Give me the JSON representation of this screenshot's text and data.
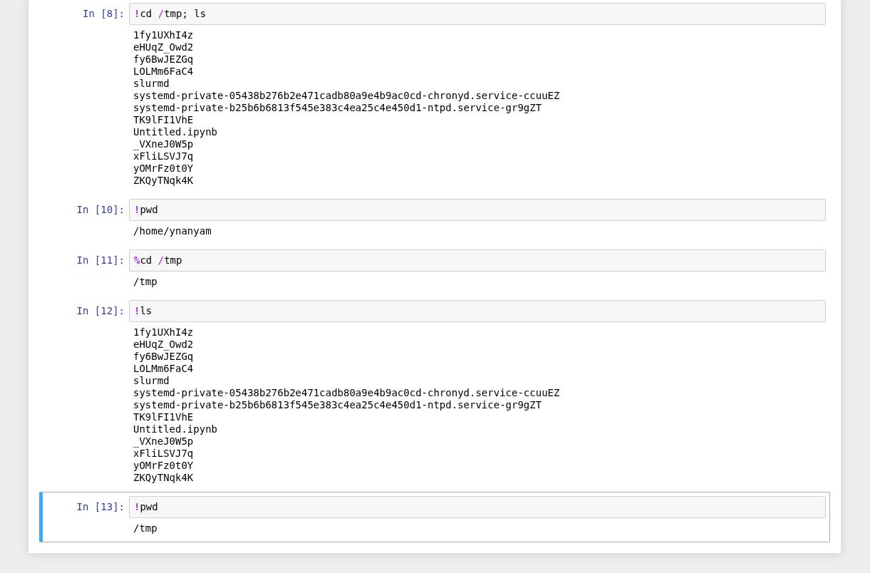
{
  "cells": [
    {
      "prompt": "In [8]:",
      "selected": false,
      "code": [
        {
          "kind": "magic",
          "text": "!"
        },
        {
          "kind": "plain",
          "text": "cd "
        },
        {
          "kind": "operator",
          "text": "/"
        },
        {
          "kind": "plain",
          "text": "tmp; ls"
        }
      ],
      "output": [
        "1fy1UXhI4z",
        "eHUqZ_Owd2",
        "fy6BwJEZGq",
        "LOLMm6FaC4",
        "slurmd",
        "systemd-private-05438b276b2e471cadb80a9e4b9ac0cd-chronyd.service-ccuuEZ",
        "systemd-private-b25b6b6813f545e383c4ea25c4e450d1-ntpd.service-gr9gZT",
        "TK9lFI1VhE",
        "Untitled.ipynb",
        "_VXneJ0W5p",
        "xFliLSVJ7q",
        "yOMrFz0t0Y",
        "ZKQyTNqk4K"
      ]
    },
    {
      "prompt": "In [10]:",
      "selected": false,
      "code": [
        {
          "kind": "magic",
          "text": "!"
        },
        {
          "kind": "plain",
          "text": "pwd"
        }
      ],
      "output": [
        "/home/ynanyam"
      ]
    },
    {
      "prompt": "In [11]:",
      "selected": false,
      "code": [
        {
          "kind": "magic",
          "text": "%"
        },
        {
          "kind": "plain",
          "text": "cd "
        },
        {
          "kind": "operator",
          "text": "/"
        },
        {
          "kind": "plain",
          "text": "tmp"
        }
      ],
      "output": [
        "/tmp"
      ]
    },
    {
      "prompt": "In [12]:",
      "selected": false,
      "code": [
        {
          "kind": "magic",
          "text": "!"
        },
        {
          "kind": "plain",
          "text": "ls"
        }
      ],
      "output": [
        "1fy1UXhI4z",
        "eHUqZ_Owd2",
        "fy6BwJEZGq",
        "LOLMm6FaC4",
        "slurmd",
        "systemd-private-05438b276b2e471cadb80a9e4b9ac0cd-chronyd.service-ccuuEZ",
        "systemd-private-b25b6b6813f545e383c4ea25c4e450d1-ntpd.service-gr9gZT",
        "TK9lFI1VhE",
        "Untitled.ipynb",
        "_VXneJ0W5p",
        "xFliLSVJ7q",
        "yOMrFz0t0Y",
        "ZKQyTNqk4K"
      ]
    },
    {
      "prompt": "In [13]:",
      "selected": true,
      "code": [
        {
          "kind": "magic",
          "text": "!"
        },
        {
          "kind": "plain",
          "text": "pwd"
        }
      ],
      "output": [
        "/tmp"
      ]
    }
  ]
}
